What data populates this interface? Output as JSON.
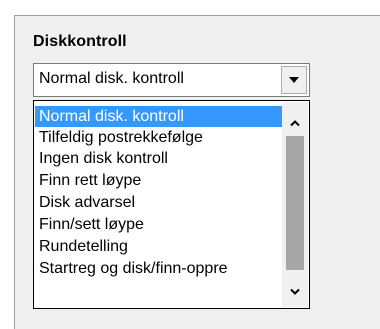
{
  "group": {
    "title": "Diskkontroll"
  },
  "combo": {
    "selected_value": "Normal disk. kontroll",
    "button_icon": "chevron-down-icon"
  },
  "dropdown": {
    "items": [
      {
        "label": "Normal disk. kontroll",
        "selected": true
      },
      {
        "label": "Tilfeldig postrekkefølge",
        "selected": false
      },
      {
        "label": "Ingen disk kontroll",
        "selected": false
      },
      {
        "label": "Finn rett løype",
        "selected": false
      },
      {
        "label": "Disk advarsel",
        "selected": false
      },
      {
        "label": "Finn/sett løype",
        "selected": false
      },
      {
        "label": "Rundetelling",
        "selected": false
      },
      {
        "label": "Startreg og disk/finn-oppre",
        "selected": false
      }
    ],
    "scroll_up_icon": "chevron-up-icon",
    "scroll_down_icon": "chevron-down-icon"
  },
  "colors": {
    "selection": "#3399ff",
    "panel_background": "#f0f0f0",
    "scroll_thumb": "#a6a6a6"
  }
}
